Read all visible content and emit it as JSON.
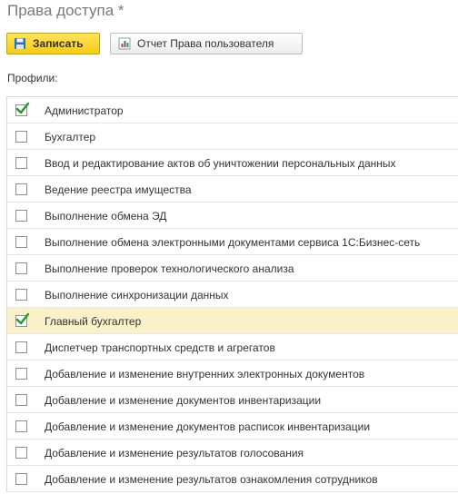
{
  "window": {
    "title": "Права доступа *"
  },
  "toolbar": {
    "save_label": "Записать",
    "save_icon": "floppy-disk-icon",
    "report_label": "Отчет Права пользователя",
    "report_icon": "bar-chart-report-icon"
  },
  "profiles": {
    "label": "Профили:",
    "items": [
      {
        "label": "Администратор",
        "checked": true
      },
      {
        "label": "Бухгалтер",
        "checked": false
      },
      {
        "label": "Ввод и редактирование актов об уничтожении персональных данных",
        "checked": false
      },
      {
        "label": "Ведение реестра имущества",
        "checked": false
      },
      {
        "label": "Выполнение обмена ЭД",
        "checked": false
      },
      {
        "label": "Выполнение обмена электронными документами сервиса 1С:Бизнес-сеть",
        "checked": false
      },
      {
        "label": "Выполнение проверок технологического анализа",
        "checked": false
      },
      {
        "label": "Выполнение синхронизации данных",
        "checked": false
      },
      {
        "label": "Главный бухгалтер",
        "checked": true,
        "selected": true
      },
      {
        "label": "Диспетчер транспортных средств и агрегатов",
        "checked": false
      },
      {
        "label": "Добавление и изменение внутренних электронных документов",
        "checked": false
      },
      {
        "label": "Добавление и изменение документов инвентаризации",
        "checked": false
      },
      {
        "label": "Добавление и изменение документов расписок инвентаризации",
        "checked": false
      },
      {
        "label": "Добавление и изменение результатов голосования",
        "checked": false
      },
      {
        "label": "Добавление и изменение результатов ознакомления сотрудников",
        "checked": false
      }
    ]
  },
  "colors": {
    "accent_yellow": "#f5cc14",
    "check_green": "#1f9b2a",
    "selected_row": "#fbf1c8"
  }
}
